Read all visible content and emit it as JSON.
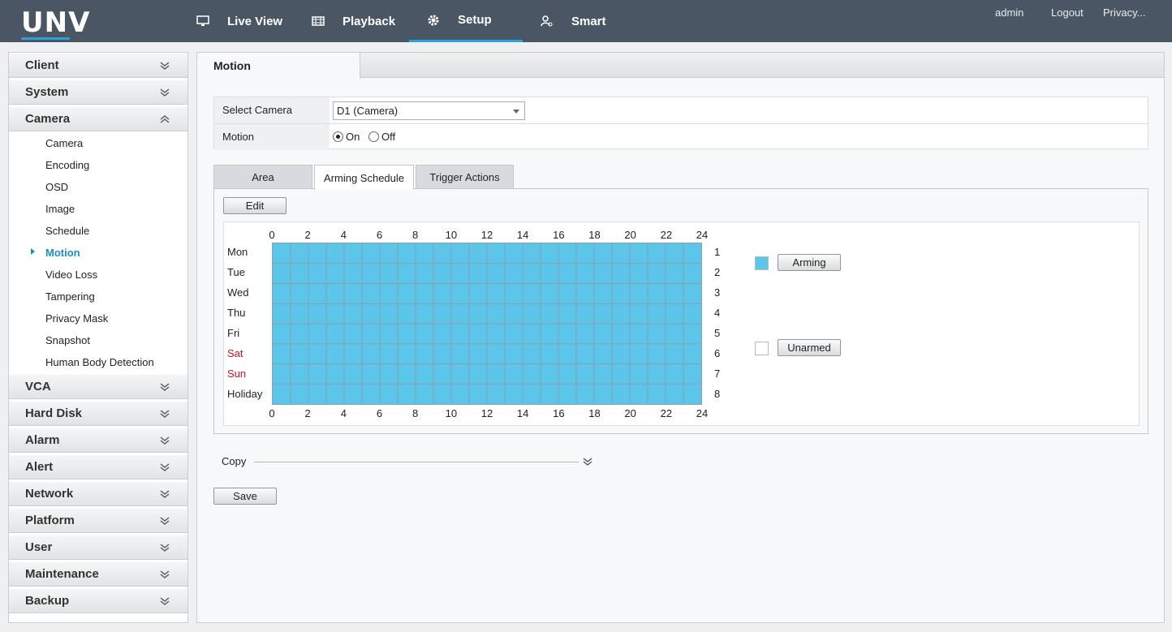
{
  "brand": {
    "logo_text": "UNV",
    "accent": "#2aa3dc"
  },
  "topnav": {
    "items": [
      {
        "label": "Live View",
        "icon": "monitor-icon"
      },
      {
        "label": "Playback",
        "icon": "film-icon"
      },
      {
        "label": "Setup",
        "icon": "gear-icon",
        "active": true
      },
      {
        "label": "Smart",
        "icon": "person-search-icon"
      }
    ],
    "links": {
      "user": "admin",
      "logout": "Logout",
      "privacy": "Privacy..."
    }
  },
  "sidebar": {
    "sections": [
      {
        "label": "Client",
        "expanded": false
      },
      {
        "label": "System",
        "expanded": false
      },
      {
        "label": "Camera",
        "expanded": true
      },
      {
        "label": "VCA",
        "expanded": false
      },
      {
        "label": "Hard Disk",
        "expanded": false
      },
      {
        "label": "Alarm",
        "expanded": false
      },
      {
        "label": "Alert",
        "expanded": false
      },
      {
        "label": "Network",
        "expanded": false
      },
      {
        "label": "Platform",
        "expanded": false
      },
      {
        "label": "User",
        "expanded": false
      },
      {
        "label": "Maintenance",
        "expanded": false
      },
      {
        "label": "Backup",
        "expanded": false
      }
    ],
    "camera_items": [
      "Camera",
      "Encoding",
      "OSD",
      "Image",
      "Schedule",
      "Motion",
      "Video Loss",
      "Tampering",
      "Privacy Mask",
      "Snapshot",
      "Human Body Detection"
    ],
    "active_item": "Motion"
  },
  "main": {
    "title": "Motion",
    "select_camera_label": "Select Camera",
    "select_camera_value": "D1 (Camera)",
    "motion_label": "Motion",
    "motion_on": "On",
    "motion_off": "Off",
    "motion_state": "On",
    "tabs": [
      "Area",
      "Arming Schedule",
      "Trigger Actions"
    ],
    "active_tab": "Arming Schedule",
    "edit_button": "Edit",
    "schedule": {
      "hour_labels": [
        "0",
        "2",
        "4",
        "6",
        "8",
        "10",
        "12",
        "14",
        "16",
        "18",
        "20",
        "22",
        "24"
      ],
      "days": [
        {
          "name": "Mon",
          "num": "1",
          "weekend": false
        },
        {
          "name": "Tue",
          "num": "2",
          "weekend": false
        },
        {
          "name": "Wed",
          "num": "3",
          "weekend": false
        },
        {
          "name": "Thu",
          "num": "4",
          "weekend": false
        },
        {
          "name": "Fri",
          "num": "5",
          "weekend": false
        },
        {
          "name": "Sat",
          "num": "6",
          "weekend": true
        },
        {
          "name": "Sun",
          "num": "7",
          "weekend": true
        },
        {
          "name": "Holiday",
          "num": "8",
          "weekend": false
        }
      ],
      "armed_color": "#5bc5ea",
      "legend_arming": "Arming",
      "legend_unarmed": "Unarmed"
    },
    "copy_label": "Copy",
    "save_button": "Save"
  }
}
